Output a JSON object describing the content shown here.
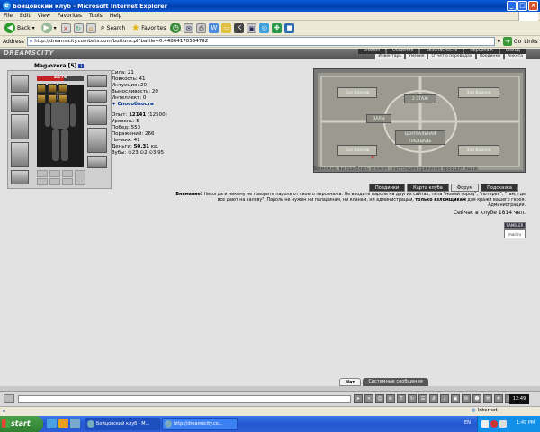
{
  "window": {
    "title": "Бойцовский клуб - Microsoft Internet Explorer"
  },
  "menu": [
    "File",
    "Edit",
    "View",
    "Favorites",
    "Tools",
    "Help"
  ],
  "toolbar": {
    "back": "Back",
    "search": "Search",
    "favorites": "Favorites"
  },
  "address": {
    "label": "Address",
    "url": "http://dreamscity.combats.com/buttons.pl?battle=0.44864178534792",
    "go": "Go",
    "links": "Links"
  },
  "site": {
    "logo": "DREAMSCITY",
    "top_nav": [
      "Знания",
      "Общение",
      "Безопасность",
      "Персонаж",
      "Выход"
    ],
    "sub_nav": [
      "Инвентарь",
      "Умения",
      "Отчет о переводах",
      "Поединки",
      "Анкета"
    ]
  },
  "character": {
    "name": "Mag-ozera",
    "level": "[5]",
    "hp_text": "44/76",
    "hp_fraction": 0.58,
    "strength": "Сила: 21",
    "agility": "Ловкость: 41",
    "intuition": "Интуиция: 20",
    "endurance": "Выносливость: 20",
    "intellect": "Интеллект: 0",
    "abilities_link": "+ Способности",
    "exp_label": "Опыт:",
    "exp_value": "12141",
    "exp_next": "(12500)",
    "level_line": "Уровень: 5",
    "wins": "Побед: 553",
    "losses": "Поражений: 266",
    "draws": "Ничьих: 41",
    "money_label": "Деньги:",
    "money_value": "50.31",
    "money_unit": "кр.",
    "teeth": "Зубы: ⊙23 ⊙2 ⊙3.95"
  },
  "map": {
    "floor": "2 ЭТАЖ",
    "hall": "ЗАЛЫ",
    "central": "ЦЕНТРАЛЬНАЯ ПЛОЩАДЬ",
    "room_a": "Зал Воинов",
    "room_b": "Зал Воинов",
    "room_c": "Зал Воинов",
    "room_d": "Зал Воинов",
    "caption": "Возможно, вы ошиблись этажом - настоящие сражения проходят выше."
  },
  "club_buttons": [
    "Поединки",
    "Карта клуба",
    "Форум",
    "Подсказка"
  ],
  "warning": {
    "label": "Внимание!",
    "text": "Никогда и никому не говорите пароль от своего персонажа. Не вводите пароль на других сайтах, типа \"новый город\", \"лотерея\", \"там, где все дают на халяву\". Пароль не нужен ни паладинам, ни кланам, ни администрации,",
    "link": "только взломщикам",
    "text2": "для кражи вашего героя.",
    "signature": "Администрация."
  },
  "online": "Сейчас в клубе 1814 чел.",
  "counters": [
    "RAMBLER",
    "mail.ru"
  ],
  "chat_tabs": [
    "Чат",
    "Системные сообщения"
  ],
  "chat_time": "12:49",
  "statusbar": {
    "zone": "Internet"
  },
  "taskbar": {
    "start": "start",
    "tasks": [
      "Бойцовский клуб - M...",
      "http://dreamscity.co..."
    ],
    "lang": "EN",
    "clock": "1:49 PM"
  }
}
